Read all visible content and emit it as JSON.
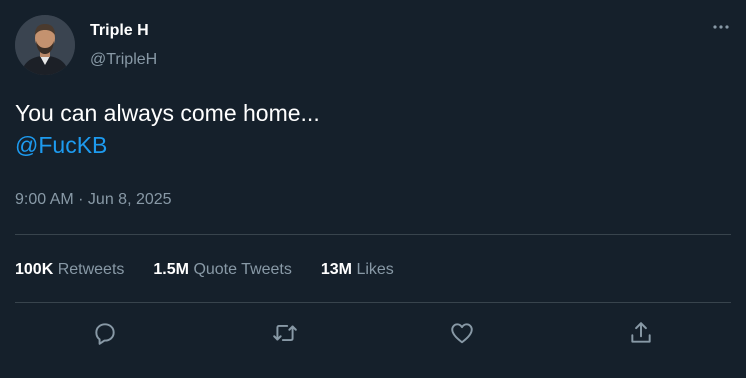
{
  "author": {
    "display_name": "Triple H",
    "handle": "@TripleH",
    "avatar_icon": "profile-avatar"
  },
  "tweet": {
    "line1": "You can always come home...",
    "mention": "@FucKB",
    "timestamp": "9:00 AM · Jun 8, 2025"
  },
  "stats": {
    "retweets_count": "100K",
    "retweets_label": "Retweets",
    "quote_tweets_count": "1.5M",
    "quote_tweets_label": "Quote Tweets",
    "likes_count": "13M",
    "likes_label": "Likes"
  },
  "actions": {
    "reply_icon": "reply-icon",
    "retweet_icon": "retweet-icon",
    "like_icon": "heart-icon",
    "share_icon": "share-icon",
    "more_icon": "more-options-icon"
  },
  "colors": {
    "background": "#15202b",
    "text_primary": "#ffffff",
    "text_secondary": "#8899a6",
    "accent": "#1d9bf0",
    "divider": "#38444d"
  }
}
